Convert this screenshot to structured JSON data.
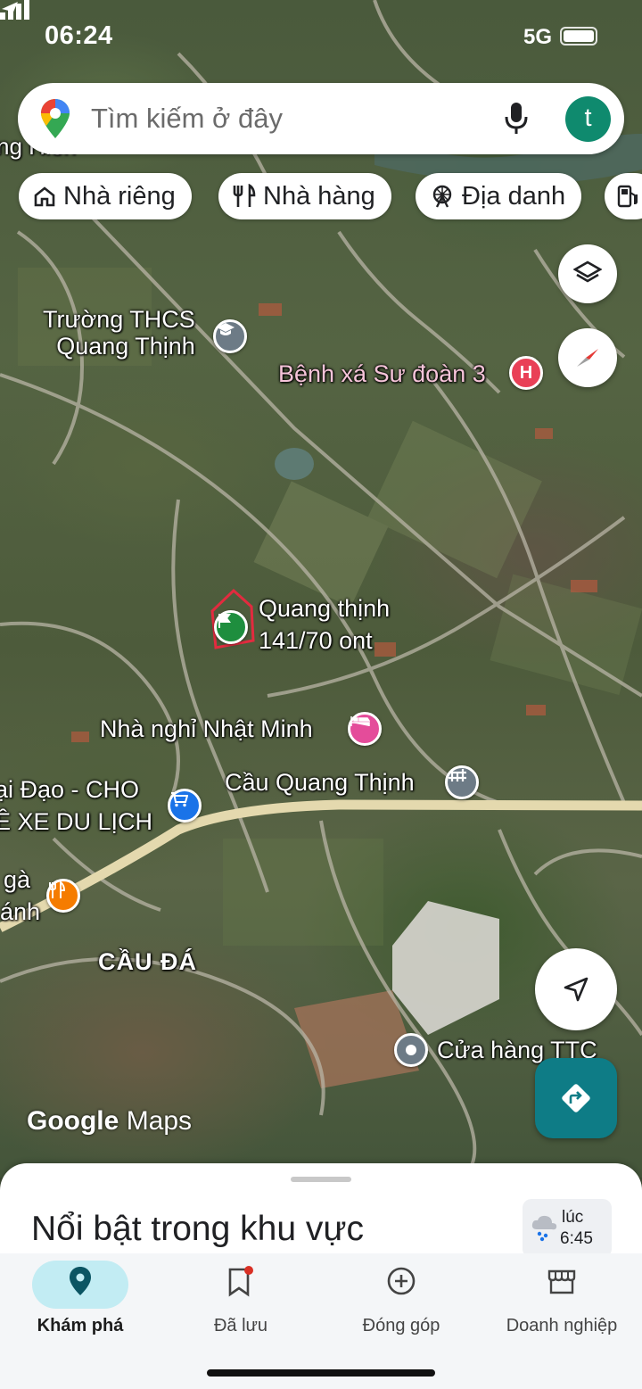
{
  "status": {
    "time": "06:24",
    "network": "5G"
  },
  "search": {
    "placeholder": "Tìm kiếm ở đây",
    "avatar_letter": "t"
  },
  "chips": [
    "Nhà riêng",
    "Nhà hàng",
    "Địa danh"
  ],
  "map": {
    "labels": {
      "school_l1": "Trường THCS",
      "school_l2": "Quang Thịnh",
      "hospital": "Bệnh xá Sư đoàn 3",
      "parcel_l1": "Quang thịnh",
      "parcel_l2": "141/70 ont",
      "motel": "Nhà nghỉ Nhật Minh",
      "bridge": "Cầu Quang Thịnh",
      "shop_l1": "ại Đạo - CHO",
      "shop_l2": "Ê XE DU LỊCH",
      "rest_l1": "gà",
      "rest_l2": "ánh",
      "area": "CẦU ĐÁ",
      "store": "Cửa hàng TTC",
      "top_cut": "ng Hiền"
    },
    "attribution_google": "Google",
    "attribution_maps": "Maps"
  },
  "sheet": {
    "title": "Nổi bật trong khu vực",
    "weather_prefix": "lúc",
    "weather_time": "6:45"
  },
  "nav": [
    {
      "label": "Khám phá",
      "icon": "location-pin-icon",
      "active": true
    },
    {
      "label": "Đã lưu",
      "icon": "bookmark-icon",
      "active": false
    },
    {
      "label": "Đóng góp",
      "icon": "add-circle-icon",
      "active": false
    },
    {
      "label": "Doanh nghiệp",
      "icon": "storefront-icon",
      "active": false
    }
  ],
  "colors": {
    "accent": "#0e7c86",
    "avatar": "#0f8a6e",
    "active_pill": "#c2ecf3",
    "hospital": "#e94057",
    "motel": "#e44c9a",
    "shopping": "#1a73e8",
    "food": "#f57c00"
  }
}
